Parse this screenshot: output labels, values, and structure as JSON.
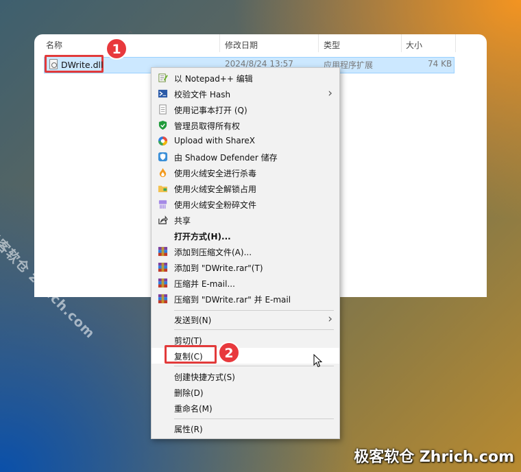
{
  "columns": {
    "name": "名称",
    "modified": "修改日期",
    "type": "类型",
    "size": "大小"
  },
  "file": {
    "name": "DWrite.dll",
    "modified": "2024/8/24 13:57",
    "type": "应用程序扩展",
    "size": "74 KB"
  },
  "badges": {
    "one": "1",
    "two": "2"
  },
  "menu": {
    "notepad": "以 Notepad++ 编辑",
    "hash": "校验文件 Hash",
    "notepad_open": "使用记事本打开 (Q)",
    "admin": "管理员取得所有权",
    "sharex": "Upload with ShareX",
    "shadow": "由 Shadow Defender 储存",
    "scan": "使用火绒安全进行杀毒",
    "unlock": "使用火绒安全解锁占用",
    "shred": "使用火绒安全粉碎文件",
    "share": "共享",
    "open_with": "打开方式(H)...",
    "add_archive": "添加到压缩文件(A)...",
    "add_rar": "添加到 \"DWrite.rar\"(T)",
    "zip_email": "压缩并 E-mail...",
    "zip_rar_email": "压缩到 \"DWrite.rar\" 并 E-mail",
    "send_to": "发送到(N)",
    "cut": "剪切(T)",
    "copy": "复制(C)",
    "shortcut": "创建快捷方式(S)",
    "delete": "删除(D)",
    "rename": "重命名(M)",
    "properties": "属性(R)"
  },
  "watermark": {
    "diagonal": "极客软仓 zhrich.com",
    "corner": "极客软仓 Zhrich.com"
  },
  "colors": {
    "accent_red": "#e8393d",
    "selection": "#cce8ff"
  }
}
